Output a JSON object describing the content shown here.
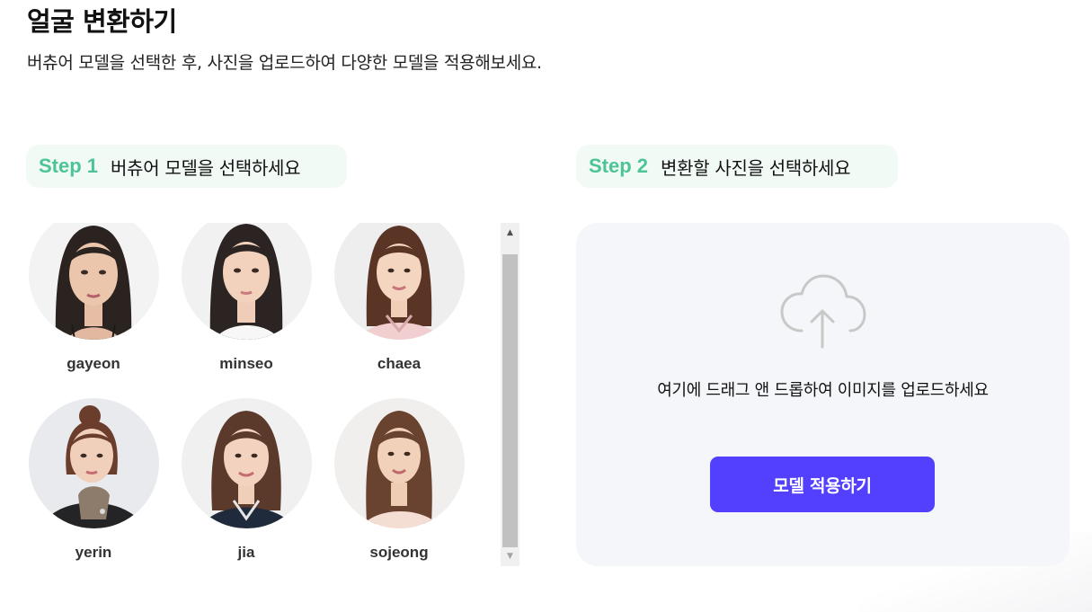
{
  "header": {
    "title": "얼굴 변환하기",
    "subtitle": "버츄어 모델을 선택한 후, 사진을 업로드하여 다양한 모델을 적용해보세요."
  },
  "step1": {
    "number": "Step 1",
    "text": "버츄어 모델을 선택하세요"
  },
  "step2": {
    "number": "Step 2",
    "text": "변환할 사진을 선택하세요"
  },
  "models": [
    {
      "name": "gayeon"
    },
    {
      "name": "minseo"
    },
    {
      "name": "chaea"
    },
    {
      "name": "yerin"
    },
    {
      "name": "jia"
    },
    {
      "name": "sojeong"
    }
  ],
  "upload": {
    "icon": "cloud-upload-icon",
    "drop_text": "여기에 드래그 앤 드롭하여 이미지를 업로드하세요",
    "apply_button": "모델 적용하기"
  },
  "colors": {
    "step_accent": "#4cc496",
    "step_bg": "#f2faf6",
    "button": "#5340ff",
    "upload_bg": "#f5f6fa"
  }
}
